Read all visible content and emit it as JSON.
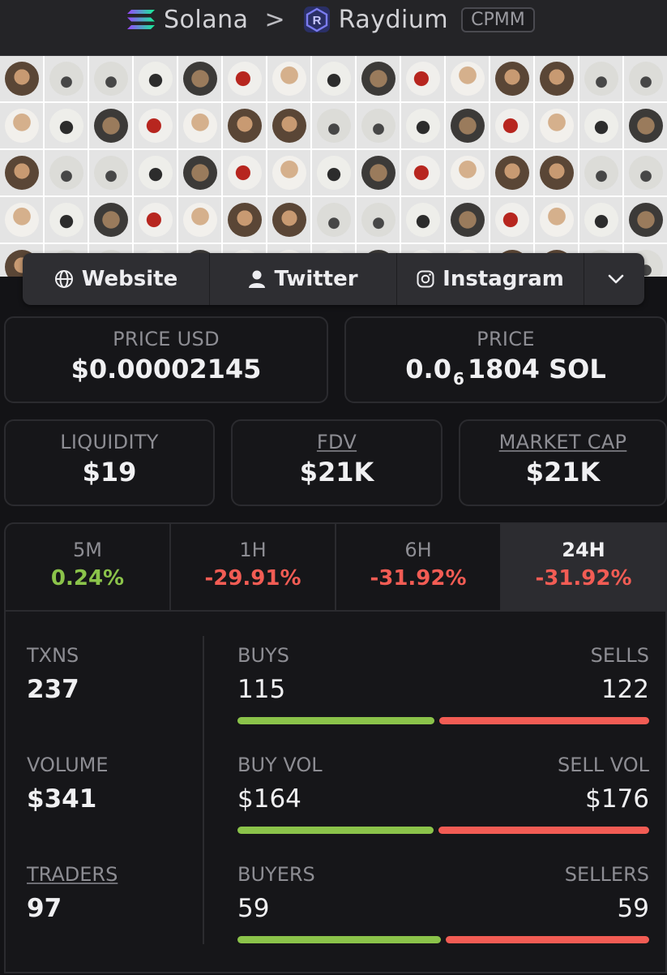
{
  "header": {
    "chain": "Solana",
    "separator": ">",
    "dex": "Raydium",
    "pool_type": "CPMM"
  },
  "links": [
    {
      "label": "Website",
      "icon": "globe-icon"
    },
    {
      "label": "Twitter",
      "icon": "user-icon"
    },
    {
      "label": "Instagram",
      "icon": "instagram-icon"
    }
  ],
  "price": {
    "usd_label": "PRICE USD",
    "usd_value": "$0.00002145",
    "native_label": "PRICE",
    "native_prefix": "0.0",
    "native_zeros": "6",
    "native_rest": "1804 SOL"
  },
  "stats": {
    "liquidity_label": "LIQUIDITY",
    "liquidity_value": "$19",
    "fdv_label": "FDV",
    "fdv_value": "$21K",
    "mcap_label": "MARKET CAP",
    "mcap_value": "$21K"
  },
  "timeframes": [
    {
      "label": "5M",
      "change": "0.24%",
      "direction": "up"
    },
    {
      "label": "1H",
      "change": "-29.91%",
      "direction": "down"
    },
    {
      "label": "6H",
      "change": "-31.92%",
      "direction": "down"
    },
    {
      "label": "24H",
      "change": "-31.92%",
      "direction": "down",
      "active": true
    }
  ],
  "metrics": {
    "txns_label": "TXNS",
    "txns_value": "237",
    "volume_label": "VOLUME",
    "volume_value": "$341",
    "traders_label": "TRADERS",
    "traders_value": "97",
    "buys_label": "BUYS",
    "buys_value": "115",
    "sells_label": "SELLS",
    "sells_value": "122",
    "buy_vol_label": "BUY VOL",
    "buy_vol_value": "$164",
    "sell_vol_label": "SELL VOL",
    "sell_vol_value": "$176",
    "buyers_label": "BUYERS",
    "buyers_value": "59",
    "sellers_label": "SELLERS",
    "sellers_value": "59"
  },
  "ratios": {
    "txns_buy_fraction": 0.485,
    "volume_buy_fraction": 0.482,
    "makers_buy_fraction": 0.5
  },
  "colors": {
    "positive": "#8bc34a",
    "negative": "#f25c54",
    "background": "#131316"
  }
}
